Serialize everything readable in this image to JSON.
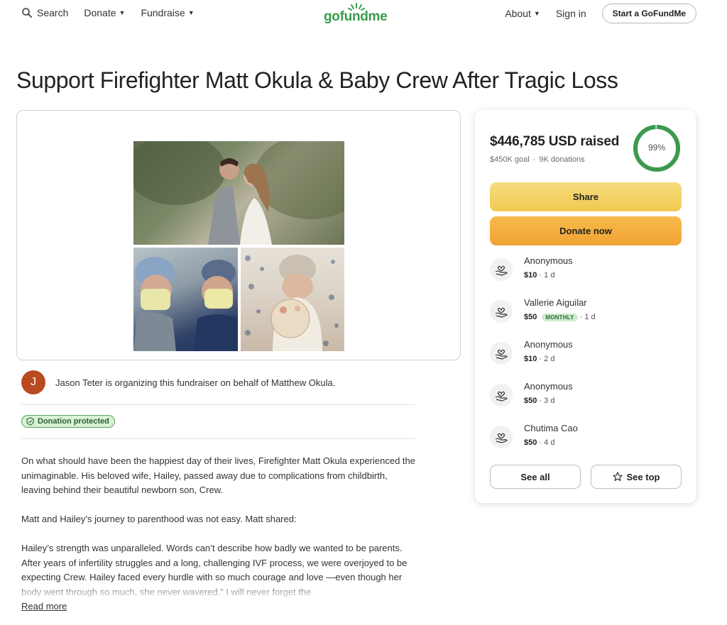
{
  "header": {
    "search_label": "Search",
    "donate_label": "Donate",
    "fundraise_label": "Fundraise",
    "logo_text": "gofundme",
    "about_label": "About",
    "signin_label": "Sign in",
    "start_label": "Start a GoFundMe",
    "brand_color": "#3c9a4e"
  },
  "campaign": {
    "title": "Support Firefighter Matt Okula & Baby Crew After Tragic Loss"
  },
  "organizer": {
    "avatar_initial": "J",
    "avatar_color": "#b84a1f",
    "text": "Jason Teter is organizing this fundraiser on behalf of Matthew Okula."
  },
  "badge": {
    "label": "Donation protected"
  },
  "story": {
    "paragraphs": [
      "On what should have been the happiest day of their lives, Firefighter Matt Okula experienced the unimaginable. His beloved wife, Hailey, passed away due to complications from childbirth, leaving behind their beautiful newborn son, Crew.",
      "Matt and Hailey’s journey to parenthood was not easy. Matt shared:",
      "Hailey’s strength was unparalleled. Words can’t describe how badly we wanted to be parents. After years of infertility struggles and a long, challenging IVF process, we were overjoyed to be expecting Crew. Hailey faced every hurdle with so much courage and love —even though her body went through so much, she never wavered.” I will never forget the"
    ],
    "read_more": "Read more"
  },
  "sidebar": {
    "raised": "$446,785 USD raised",
    "goal": "$450K goal",
    "donations": "9K donations",
    "progress_label": "99%",
    "progress": 0.99,
    "progress_color": "#3c9a4e",
    "share_label": "Share",
    "donate_label": "Donate now",
    "donors": [
      {
        "name": "Anonymous",
        "amount": "$10",
        "time": "1 d",
        "badge": ""
      },
      {
        "name": "Vallerie Aiguilar",
        "amount": "$50",
        "time": "1 d",
        "badge": "MONTHLY"
      },
      {
        "name": "Anonymous",
        "amount": "$10",
        "time": "2 d",
        "badge": ""
      },
      {
        "name": "Anonymous",
        "amount": "$50",
        "time": "3 d",
        "badge": ""
      },
      {
        "name": "Chutima Cao",
        "amount": "$50",
        "time": "4 d",
        "badge": ""
      }
    ],
    "see_all_label": "See all",
    "see_top_label": "See top"
  },
  "icons": {
    "search": "search-icon",
    "shield": "shield-icon",
    "donation": "heart-hand-icon",
    "star": "star-icon"
  }
}
